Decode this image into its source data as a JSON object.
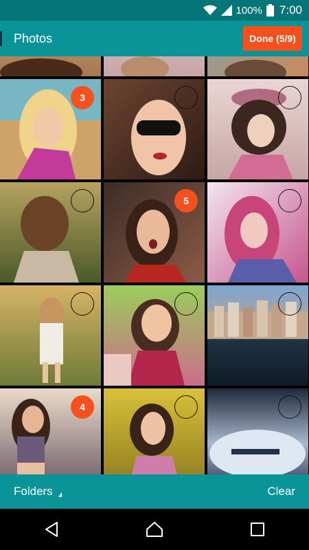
{
  "status_bar": {
    "battery_percent": "100%",
    "time": "7:00",
    "icons": [
      "wifi-icon",
      "signal-icon",
      "battery-icon"
    ]
  },
  "header": {
    "title": "Photos",
    "done_label": "Done (5/9)"
  },
  "grid": {
    "cells": [
      {
        "selected": false,
        "badge": ""
      },
      {
        "selected": false,
        "badge": ""
      },
      {
        "selected": false,
        "badge": ""
      },
      {
        "selected": true,
        "badge": "3"
      },
      {
        "selected": false,
        "badge": ""
      },
      {
        "selected": false,
        "badge": ""
      },
      {
        "selected": false,
        "badge": ""
      },
      {
        "selected": true,
        "badge": "5"
      },
      {
        "selected": false,
        "badge": ""
      },
      {
        "selected": false,
        "badge": ""
      },
      {
        "selected": false,
        "badge": ""
      },
      {
        "selected": false,
        "badge": ""
      },
      {
        "selected": true,
        "badge": "4"
      },
      {
        "selected": false,
        "badge": ""
      },
      {
        "selected": false,
        "badge": ""
      }
    ]
  },
  "bottom_bar": {
    "folders_label": "Folders",
    "clear_label": "Clear"
  },
  "nav_bar": {
    "icons": [
      "back-icon",
      "home-icon",
      "recents-icon"
    ]
  },
  "colors": {
    "accent": "#f4511e",
    "primary": "#0a9498",
    "primary_dark": "#06757a"
  }
}
